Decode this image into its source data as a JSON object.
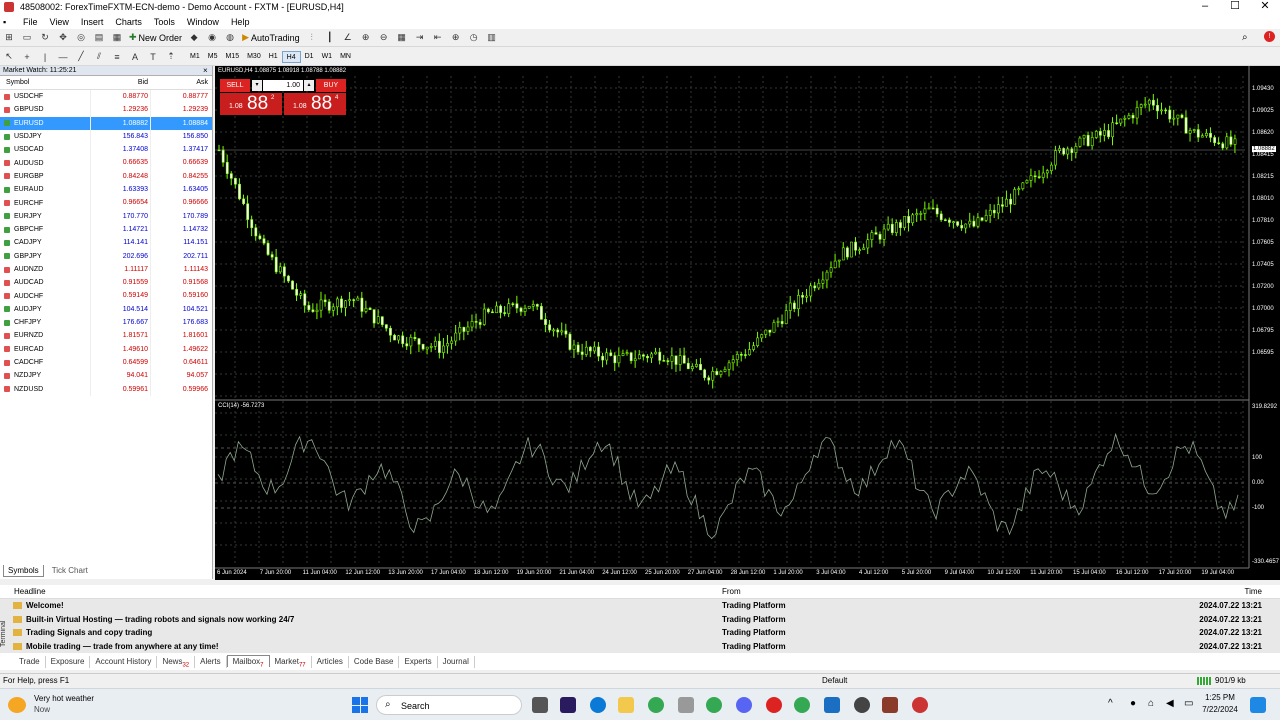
{
  "window": {
    "title": "48508002: ForexTimeFXTM-ECN-demo - Demo Account - FXTM - [EURUSD,H4]"
  },
  "menu": [
    "File",
    "View",
    "Insert",
    "Charts",
    "Tools",
    "Window",
    "Help"
  ],
  "toolbar": {
    "new_order": "New Order",
    "autotrading": "AutoTrading"
  },
  "timeframes": [
    "M1",
    "M5",
    "M15",
    "M30",
    "H1",
    "H4",
    "D1",
    "W1",
    "MN"
  ],
  "active_timeframe": "H4",
  "market_watch": {
    "title": "Market Watch: 11:25:21",
    "col_symbol": "Symbol",
    "col_bid": "Bid",
    "col_ask": "Ask",
    "rows": [
      {
        "s": "USDCHF",
        "b": "0.88770",
        "a": "0.88777",
        "d": "dn"
      },
      {
        "s": "GBPUSD",
        "b": "1.29236",
        "a": "1.29239",
        "d": "dn"
      },
      {
        "s": "EURUSD",
        "b": "1.08882",
        "a": "1.08884",
        "d": "sel"
      },
      {
        "s": "USDJPY",
        "b": "156.843",
        "a": "156.850",
        "d": "up"
      },
      {
        "s": "USDCAD",
        "b": "1.37408",
        "a": "1.37417",
        "d": "up"
      },
      {
        "s": "AUDUSD",
        "b": "0.66635",
        "a": "0.66639",
        "d": "dn"
      },
      {
        "s": "EURGBP",
        "b": "0.84248",
        "a": "0.84255",
        "d": "dn"
      },
      {
        "s": "EURAUD",
        "b": "1.63393",
        "a": "1.63405",
        "d": "up"
      },
      {
        "s": "EURCHF",
        "b": "0.96654",
        "a": "0.96666",
        "d": "dn"
      },
      {
        "s": "EURJPY",
        "b": "170.770",
        "a": "170.789",
        "d": "up"
      },
      {
        "s": "GBPCHF",
        "b": "1.14721",
        "a": "1.14732",
        "d": "up"
      },
      {
        "s": "CADJPY",
        "b": "114.141",
        "a": "114.151",
        "d": "up"
      },
      {
        "s": "GBPJPY",
        "b": "202.696",
        "a": "202.711",
        "d": "up"
      },
      {
        "s": "AUDNZD",
        "b": "1.11117",
        "a": "1.11143",
        "d": "dn"
      },
      {
        "s": "AUDCAD",
        "b": "0.91559",
        "a": "0.91568",
        "d": "dn"
      },
      {
        "s": "AUDCHF",
        "b": "0.59149",
        "a": "0.59160",
        "d": "dn"
      },
      {
        "s": "AUDJPY",
        "b": "104.514",
        "a": "104.521",
        "d": "up"
      },
      {
        "s": "CHFJPY",
        "b": "176.667",
        "a": "176.683",
        "d": "up"
      },
      {
        "s": "EURNZD",
        "b": "1.81571",
        "a": "1.81601",
        "d": "dn"
      },
      {
        "s": "EURCAD",
        "b": "1.49610",
        "a": "1.49622",
        "d": "dn"
      },
      {
        "s": "CADCHF",
        "b": "0.64599",
        "a": "0.64611",
        "d": "dn"
      },
      {
        "s": "NZDJPY",
        "b": "94.041",
        "a": "94.057",
        "d": "dn"
      },
      {
        "s": "NZDUSD",
        "b": "0.59961",
        "a": "0.59966",
        "d": "dn"
      }
    ],
    "tabs": [
      "Symbols",
      "Tick Chart"
    ]
  },
  "chart": {
    "header": "EURUSD,H4  1.08875 1.08918 1.08788 1.08882",
    "sell": "SELL",
    "buy": "BUY",
    "lot": "1.00",
    "sell_big": "1.08",
    "sell_pips": "88",
    "sell_sup": "2",
    "buy_big": "1.08",
    "buy_pips": "88",
    "buy_sup": "4",
    "current_price": "1.08882",
    "price_ticks": [
      "1.09430",
      "1.09025",
      "1.08620",
      "1.08415",
      "1.08215",
      "1.08010",
      "1.07810",
      "1.07605",
      "1.07405",
      "1.07200",
      "1.07000",
      "1.06795",
      "1.06595"
    ],
    "cci_label": "CCI(14) -56.7273",
    "cci_ticks": [
      "319.8292",
      "100",
      "0.00",
      "-100",
      "-330.4657"
    ],
    "time_ticks": [
      "6 Jun 2024",
      "7 Jun 20:00",
      "11 Jun 04:00",
      "12 Jun 12:00",
      "13 Jun 20:00",
      "17 Jun 04:00",
      "18 Jun 12:00",
      "19 Jun 20:00",
      "21 Jun 04:00",
      "24 Jun 12:00",
      "25 Jun 20:00",
      "27 Jun 04:00",
      "28 Jun 12:00",
      "1 Jul 20:00",
      "3 Jul 04:00",
      "4 Jul 12:00",
      "5 Jul 20:00",
      "9 Jul 04:00",
      "10 Jul 12:00",
      "11 Jul 20:00",
      "15 Jul 04:00",
      "16 Jul 12:00",
      "17 Jul 20:00",
      "19 Jul 04:00"
    ]
  },
  "chart_data": {
    "type": "line",
    "title": "EURUSD,H4",
    "x": [
      "6 Jun",
      "7 Jun",
      "11 Jun",
      "12 Jun",
      "13 Jun",
      "17 Jun",
      "18 Jun",
      "19 Jun",
      "21 Jun",
      "24 Jun",
      "25 Jun",
      "27 Jun",
      "28 Jun",
      "1 Jul",
      "3 Jul",
      "4 Jul",
      "5 Jul",
      "9 Jul",
      "10 Jul",
      "11 Jul",
      "15 Jul",
      "16 Jul",
      "17 Jul",
      "19 Jul"
    ],
    "series": [
      {
        "values": [
          1.0885,
          1.0795,
          1.074,
          1.075,
          1.0715,
          1.0705,
          1.0735,
          1.0745,
          1.0705,
          1.0695,
          1.07,
          1.068,
          1.0705,
          1.0745,
          1.079,
          1.081,
          1.083,
          1.0815,
          1.0845,
          1.0885,
          1.09,
          1.093,
          1.09,
          1.0888
        ]
      }
    ],
    "ylim": [
      1.06595,
      1.0943
    ]
  },
  "terminal": {
    "cols": {
      "headline": "Headline",
      "from": "From",
      "time": "Time"
    },
    "rows": [
      {
        "h": "Welcome!",
        "f": "Trading Platform",
        "t": "2024.07.22 13:21"
      },
      {
        "h": "Built-in Virtual Hosting — trading robots and signals now working 24/7",
        "f": "Trading Platform",
        "t": "2024.07.22 13:21"
      },
      {
        "h": "Trading Signals and copy trading",
        "f": "Trading Platform",
        "t": "2024.07.22 13:21"
      },
      {
        "h": "Mobile trading — trade from anywhere at any time!",
        "f": "Trading Platform",
        "t": "2024.07.22 13:21"
      }
    ],
    "tabs": [
      "Trade",
      "Exposure",
      "Account History",
      "News",
      "Alerts",
      "Mailbox",
      "Market",
      "Articles",
      "Code Base",
      "Experts",
      "Journal"
    ],
    "tab_badges": {
      "News": "32",
      "Mailbox": "7",
      "Market": "77"
    },
    "side_label": "Terminal"
  },
  "status": {
    "help": "For Help, press F1",
    "profile": "Default",
    "traffic": "901/9 kb"
  },
  "taskbar": {
    "weather_title": "Very hot weather",
    "weather_sub": "Now",
    "search": "Search",
    "time": "1:25 PM",
    "date": "7/22/2024"
  }
}
